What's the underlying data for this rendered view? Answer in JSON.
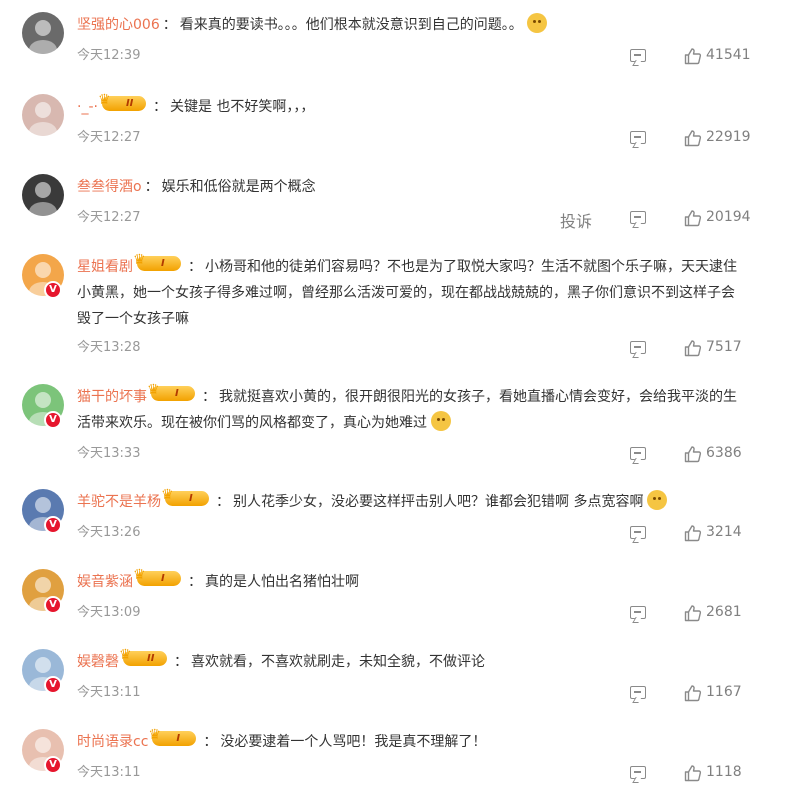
{
  "comments": [
    {
      "username": "坚强的心006",
      "level": "",
      "text": "看来真的要读书。。。他们根本就没意识到自己的问题。。",
      "emoji": true,
      "time": "今天12:39",
      "likes": "41541",
      "report": "",
      "verified": false,
      "avatar_color": "#6a6a6a"
    },
    {
      "username": "·_-·",
      "level": "II",
      "text": "关键是 也不好笑啊，，，",
      "emoji": false,
      "time": "今天12:27",
      "likes": "22919",
      "report": "",
      "verified": false,
      "avatar_color": "#d8b8b0"
    },
    {
      "username": "叁叁得酒o",
      "level": "",
      "text": "娱乐和低俗就是两个概念",
      "emoji": false,
      "time": "今天12:27",
      "likes": "20194",
      "report": "投诉",
      "verified": false,
      "avatar_color": "#3a3a3a"
    },
    {
      "username": "星姐看剧",
      "level": "I",
      "text": "小杨哥和他的徒弟们容易吗？不也是为了取悦大家吗？生活不就图个乐子嘛，天天逮住小黄黑，她一个女孩子得多难过啊，曾经那么活泼可爱的，现在都战战兢兢的，黑子你们意识不到这样子会毁了一个女孩子嘛",
      "emoji": false,
      "time": "今天13:28",
      "likes": "7517",
      "report": "",
      "verified": true,
      "avatar_color": "#f3a64a"
    },
    {
      "username": "猫干的坏事",
      "level": "I",
      "text": "我就挺喜欢小黄的，很开朗很阳光的女孩子，看她直播心情会变好，会给我平淡的生活带来欢乐。现在被你们骂的风格都变了，真心为她难过",
      "emoji": true,
      "time": "今天13:33",
      "likes": "6386",
      "report": "",
      "verified": true,
      "avatar_color": "#7cc47a"
    },
    {
      "username": "羊驼不是羊杨",
      "level": "I",
      "text": "别人花季少女，没必要这样抨击别人吧？谁都会犯错啊 多点宽容啊",
      "emoji": true,
      "time": "今天13:26",
      "likes": "3214",
      "report": "",
      "verified": true,
      "avatar_color": "#5a7ab0"
    },
    {
      "username": "娱音紫涵",
      "level": "I",
      "text": "真的是人怕出名猪怕壮啊",
      "emoji": false,
      "time": "今天13:09",
      "likes": "2681",
      "report": "",
      "verified": true,
      "avatar_color": "#e0a040"
    },
    {
      "username": "娱磬磬",
      "level": "II",
      "text": "喜欢就看，不喜欢就刷走，未知全貌，不做评论",
      "emoji": false,
      "time": "今天13:11",
      "likes": "1167",
      "report": "",
      "verified": true,
      "avatar_color": "#9ab8d8"
    },
    {
      "username": "时尚语录cc",
      "level": "I",
      "text": "没必要逮着一个人骂吧！我是真不理解了！",
      "emoji": false,
      "time": "今天13:11",
      "likes": "1118",
      "report": "",
      "verified": true,
      "avatar_color": "#e8c0b0"
    }
  ],
  "colors": {
    "username": "#eb7350",
    "text": "#333333",
    "meta": "#999999",
    "verified": "#e6162d",
    "level_badge": "#f2a100"
  }
}
